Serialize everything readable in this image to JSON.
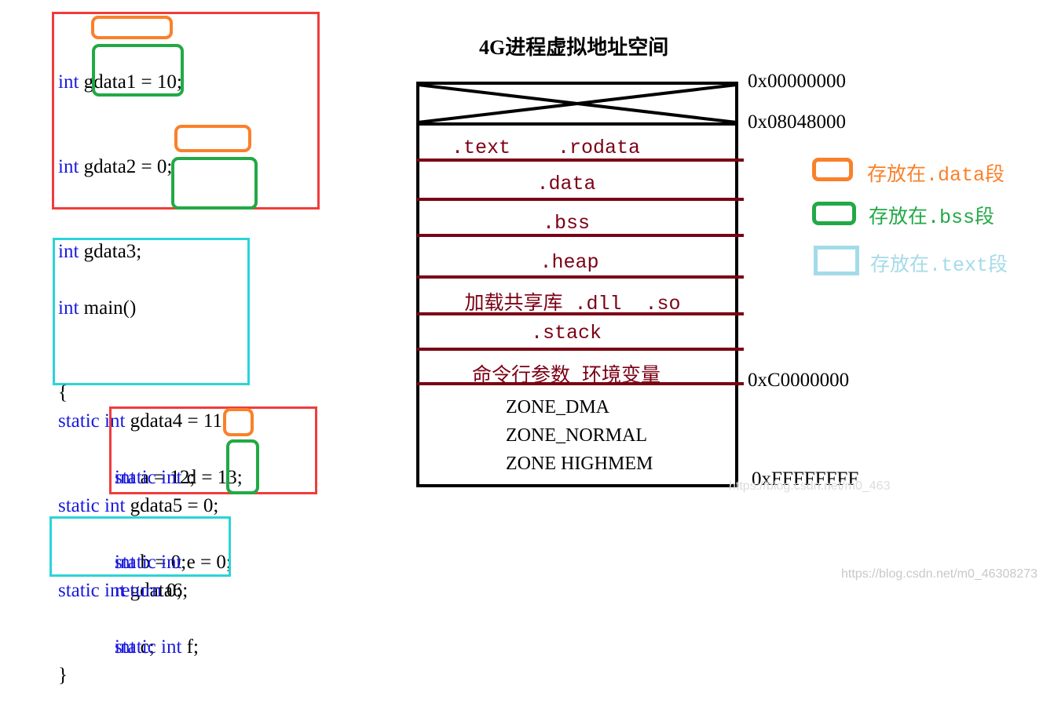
{
  "title": "4G进程虚拟地址空间",
  "code": {
    "globals_block": [
      {
        "kw": "int ",
        "name": "gdata1",
        "rest": " = 10;"
      },
      {
        "kw": "int ",
        "name": "gdata2",
        "rest": " = 0;"
      },
      {
        "kw": "int ",
        "name": "gdata3",
        "rest": ";"
      },
      {
        "kw": "",
        "name": "",
        "rest": ""
      },
      {
        "kw": "static int ",
        "name": "gdata4",
        "rest": " = 11;"
      },
      {
        "kw": "static int ",
        "name": "gdata5",
        "rest": " = 0;"
      },
      {
        "kw": "static int ",
        "name": "gdata6",
        "rest": ";"
      }
    ],
    "main_header": {
      "kw": "int",
      "rest": " main()"
    },
    "open_brace": "{",
    "locals": [
      {
        "kw": "int",
        "rest": " a = 12;"
      },
      {
        "kw": "int",
        "rest": " b = 0;"
      },
      {
        "kw": "int",
        "rest": " c;"
      }
    ],
    "static_locals": [
      {
        "kw": "static int ",
        "name": "d",
        "rest": " = 13;"
      },
      {
        "kw": "static int ",
        "name": "e",
        "rest": " = 0;"
      },
      {
        "kw": "static int ",
        "name": "f",
        "rest": ";"
      }
    ],
    "return_stmt": {
      "kw": "return",
      "rest": " 0;"
    },
    "close_brace": "}"
  },
  "memory": {
    "segments": [
      {
        "label": ".text    .rodata"
      },
      {
        "label": ".data"
      },
      {
        "label": ".bss"
      },
      {
        "label": ".heap"
      },
      {
        "label": "加载共享库 .dll  .so"
      },
      {
        "label": ".stack"
      },
      {
        "label": "命令行参数 环境变量"
      }
    ],
    "kernel_zones": [
      "ZONE_DMA",
      "ZONE_NORMAL",
      "ZONE HIGHMEM"
    ],
    "addresses": {
      "start": "0x00000000",
      "text_start": "0x08048000",
      "kernel_start": "0xC0000000",
      "end": "0xFFFFFFFF"
    }
  },
  "legend": [
    {
      "label": "存放在.data段",
      "color": "#f9812a"
    },
    {
      "label": "存放在.bss段",
      "color": "#22a945"
    },
    {
      "label": "存放在.text段",
      "color": "#a4dbe9"
    }
  ],
  "colors": {
    "keyword": "#1a1adf",
    "segment_text": "#7b0014",
    "frame_red": "#f03c3c",
    "frame_cyan": "#2ad4d8"
  },
  "watermark": "https://blog.csdn.net/m0_46308273",
  "watermark_faint": "https://blog.csdn.net/m0_463"
}
